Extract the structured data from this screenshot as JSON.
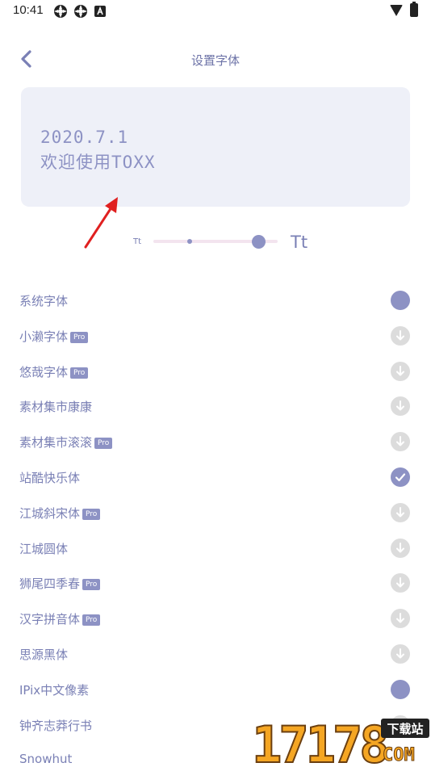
{
  "status_bar": {
    "time": "10:41"
  },
  "header": {
    "title": "设置字体"
  },
  "preview": {
    "date_text": "2020.7.1",
    "welcome_text": "欢迎使用TOXX"
  },
  "size_slider": {
    "small_label": "Tt",
    "large_label": "Tt",
    "level": 0.85
  },
  "colors": {
    "accent": "#8d92c4",
    "text": "#7a80b5",
    "card_bg": "#eef0f8",
    "download_bg": "#dcdcdc",
    "annotation_arrow": "#e02020"
  },
  "fonts": [
    {
      "name": "系统字体",
      "pro": false,
      "status": "selected-dot"
    },
    {
      "name": "小濑字体",
      "pro": true,
      "status": "download"
    },
    {
      "name": "悠哉字体",
      "pro": true,
      "status": "download"
    },
    {
      "name": "素材集市康康",
      "pro": false,
      "status": "download"
    },
    {
      "name": "素材集市滚滚",
      "pro": true,
      "status": "download"
    },
    {
      "name": "站酷快乐体",
      "pro": false,
      "status": "checked"
    },
    {
      "name": "江城斜宋体",
      "pro": true,
      "status": "download"
    },
    {
      "name": "江城圆体",
      "pro": false,
      "status": "download"
    },
    {
      "name": "狮尾四季春",
      "pro": true,
      "status": "download"
    },
    {
      "name": "汉字拼音体",
      "pro": true,
      "status": "download"
    },
    {
      "name": "思源黑体",
      "pro": false,
      "status": "download"
    },
    {
      "name": "IPix中文像素",
      "pro": false,
      "status": "selected-dot"
    },
    {
      "name": "钟齐志莽行书",
      "pro": false,
      "status": "download"
    },
    {
      "name": "Snowhut",
      "pro": false,
      "status": "none"
    }
  ],
  "pro_badge_label": "Pro",
  "watermark": {
    "digits": "17178",
    "badge": "下载站",
    "domain": "COM"
  }
}
